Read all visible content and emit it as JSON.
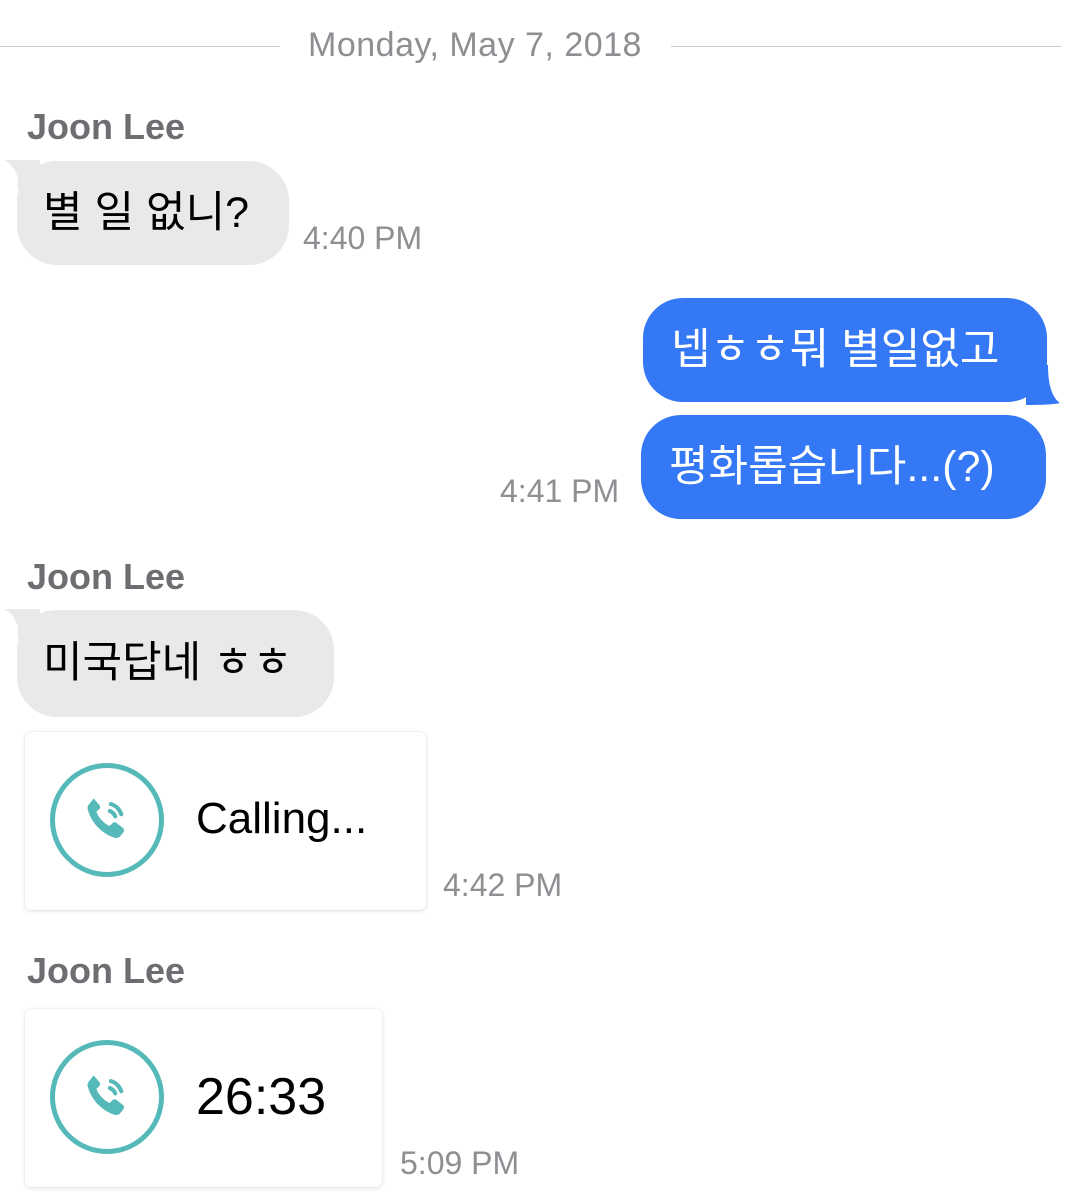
{
  "date_separator": "Monday, May 7, 2018",
  "messages": [
    {
      "sender": "Joon Lee",
      "text": "별 일 없니?",
      "time": "4:40 PM"
    },
    {
      "text": "넵ㅎㅎ뭐 별일없고"
    },
    {
      "text": "평화롭습니다...(?)",
      "time": "4:41 PM"
    },
    {
      "sender": "Joon Lee",
      "text": "미국답네 ㅎㅎ"
    },
    {
      "call_text": "Calling...",
      "time": "4:42 PM",
      "icon": "phone-call-icon"
    },
    {
      "sender": "Joon Lee",
      "call_text": "26:33",
      "time": "5:09 PM",
      "icon": "phone-call-icon"
    }
  ],
  "colors": {
    "incoming_bubble": "#e9e9eb",
    "outgoing_bubble": "#3478f6",
    "call_icon": "#55b9b9",
    "meta_text": "#8e8e93"
  }
}
